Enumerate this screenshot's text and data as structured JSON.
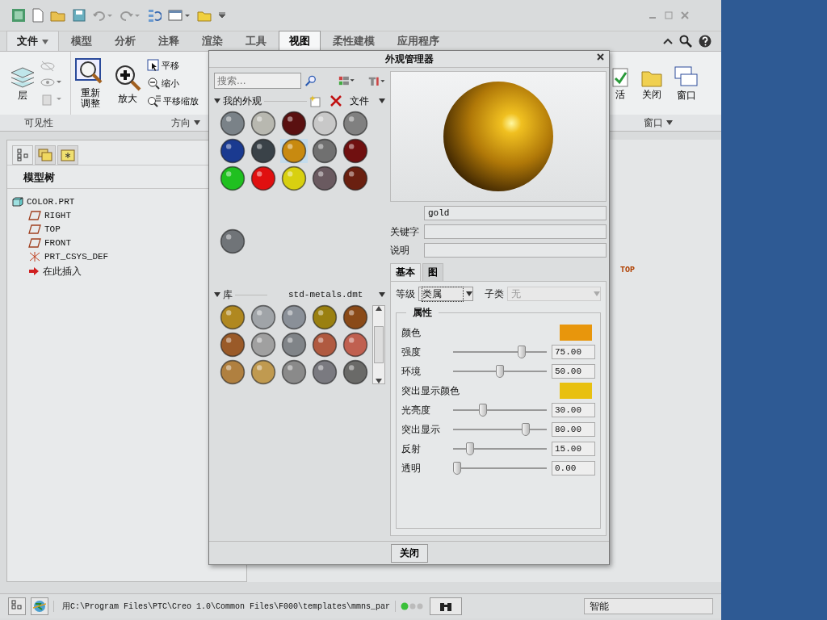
{
  "ribbon": {
    "tabs": [
      {
        "label": "文件",
        "selected": false,
        "dropdown": true
      },
      {
        "label": "模型",
        "selected": false
      },
      {
        "label": "分析",
        "selected": false
      },
      {
        "label": "注释",
        "selected": false
      },
      {
        "label": "渲染",
        "selected": false
      },
      {
        "label": "工具",
        "selected": false
      },
      {
        "label": "视图",
        "selected": true
      },
      {
        "label": "柔性建模",
        "selected": false
      },
      {
        "label": "应用程序",
        "selected": false
      }
    ],
    "visibility_group": {
      "layers": "层",
      "label": "可见性"
    },
    "orientation_group": {
      "refit": "重新调整",
      "zoom_in": "放大",
      "pan": "平移",
      "zoom_out": "缩小",
      "pan_zoom": "平移缩放",
      "label": "方向"
    },
    "window_group": {
      "activate": "活",
      "close": "关闭",
      "windows": "窗口",
      "label": "窗口"
    }
  },
  "model_tree": {
    "title": "模型树",
    "items": [
      {
        "kind": "part",
        "label": "COLOR.PRT",
        "children": [
          {
            "kind": "plane",
            "label": "RIGHT"
          },
          {
            "kind": "plane",
            "label": "TOP"
          },
          {
            "kind": "plane",
            "label": "FRONT"
          },
          {
            "kind": "csys",
            "label": "PRT_CSYS_DEF"
          },
          {
            "kind": "insert",
            "label": "在此插入"
          }
        ]
      }
    ]
  },
  "graphics": {
    "datum_label": "TOP"
  },
  "dialog": {
    "title": "外观管理器",
    "search": {
      "placeholder": "搜索..."
    },
    "my_appearances": {
      "title": "我的外观",
      "file_menu": "文件",
      "spheres": [
        {
          "color": "#7a8288",
          "selected": false
        },
        {
          "color": "#b8b8b0",
          "selected": false
        },
        {
          "color": "#5a1010",
          "selected": false
        },
        {
          "color": "#c8c8c8",
          "selected": false
        },
        {
          "color": "#808080",
          "selected": false
        },
        {
          "color": "#1a3a90",
          "selected": false
        },
        {
          "color": "#3a4248",
          "selected": false
        },
        {
          "color": "#c88a10",
          "selected": true
        },
        {
          "color": "#707070",
          "selected": false
        },
        {
          "color": "#701010",
          "selected": false
        },
        {
          "color": "#20c020",
          "selected": false
        },
        {
          "color": "#e01010",
          "selected": false
        },
        {
          "color": "#d8d010",
          "selected": false
        },
        {
          "color": "#6a5a60",
          "selected": false
        },
        {
          "color": "#6a2010",
          "selected": false
        }
      ]
    },
    "model": {
      "spheres": [
        {
          "color": "#707478",
          "selected": false
        }
      ]
    },
    "library": {
      "title": "库",
      "file": "std-metals.dmt",
      "spheres": [
        {
          "color": "#b08820",
          "selected": false
        },
        {
          "color": "#a0a4a8",
          "selected": false
        },
        {
          "color": "#8a9098",
          "selected": false
        },
        {
          "color": "#9a8010",
          "selected": false
        },
        {
          "color": "#8a4a18",
          "selected": false
        },
        {
          "color": "#9a5a28",
          "selected": false
        },
        {
          "color": "#a0a0a0",
          "selected": false
        },
        {
          "color": "#808488",
          "selected": false
        },
        {
          "color": "#b05a40",
          "selected": false
        },
        {
          "color": "#c06050",
          "selected": false
        },
        {
          "color": "#b08040",
          "selected": false
        },
        {
          "color": "#c09a50",
          "selected": false
        },
        {
          "color": "#8a8a8a",
          "selected": false
        },
        {
          "color": "#7a7a80",
          "selected": false
        },
        {
          "color": "#6a6a68",
          "selected": false
        }
      ]
    },
    "fields": [
      {
        "label": "关键字"
      },
      {
        "label": "说明"
      }
    ],
    "name_field": {
      "value": "gold"
    },
    "tabs": [
      {
        "label": "基本",
        "selected": true
      },
      {
        "label": "图",
        "selected": false
      }
    ],
    "class": {
      "label": "等级",
      "value": "类属"
    },
    "subclass": {
      "label": "子类",
      "value": "无",
      "disabled": true
    },
    "properties": {
      "title": "属性",
      "rows": [
        {
          "kind": "color",
          "label": "颜色",
          "color": "#e8960c"
        },
        {
          "kind": "slider",
          "label": "强度",
          "level": 0.75,
          "reading": "75.00"
        },
        {
          "kind": "slider",
          "label": "环境",
          "level": 0.5,
          "reading": "50.00"
        },
        {
          "kind": "color",
          "label": "突出显示颜色",
          "color": "#e8c010"
        },
        {
          "kind": "slider",
          "label": "光亮度",
          "level": 0.3,
          "reading": "30.00"
        },
        {
          "kind": "slider",
          "label": "突出显示",
          "level": 0.8,
          "reading": "80.00"
        },
        {
          "kind": "slider",
          "label": "反射",
          "level": 0.15,
          "reading": "15.00"
        },
        {
          "kind": "slider",
          "label": "透明",
          "level": 0,
          "reading": "0.00"
        }
      ]
    },
    "close_button": "关闭"
  },
  "status_bar": {
    "message": "用C:\\Program Files\\PTC\\Creo 1.0\\Common Files\\F000\\templates\\mmns_par",
    "filter": "智能"
  }
}
